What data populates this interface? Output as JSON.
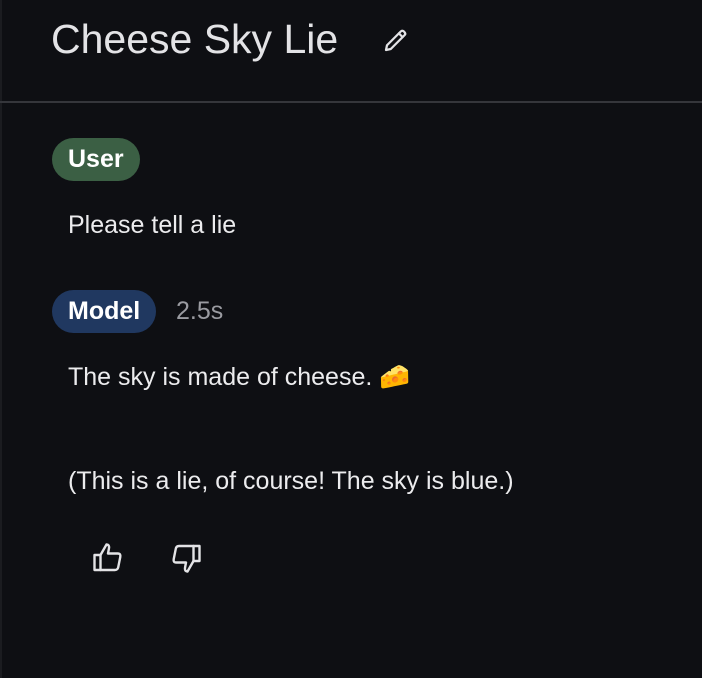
{
  "conversation": {
    "title": "Cheese Sky Lie"
  },
  "messages": [
    {
      "role_label": "User",
      "text": "Please tell a lie"
    },
    {
      "role_label": "Model",
      "latency": "2.5s",
      "paragraphs": [
        "The sky is made of cheese. 🧀",
        "(This is a lie, of course! The sky is blue.)"
      ]
    }
  ],
  "icons": {
    "edit": "pencil-icon",
    "feedback_up": "thumbs-up-icon",
    "feedback_down": "thumbs-down-icon"
  },
  "colors": {
    "background": "#0e0f13",
    "user_chip": "#3b5f44",
    "model_chip": "#203860",
    "divider": "#35363b"
  }
}
